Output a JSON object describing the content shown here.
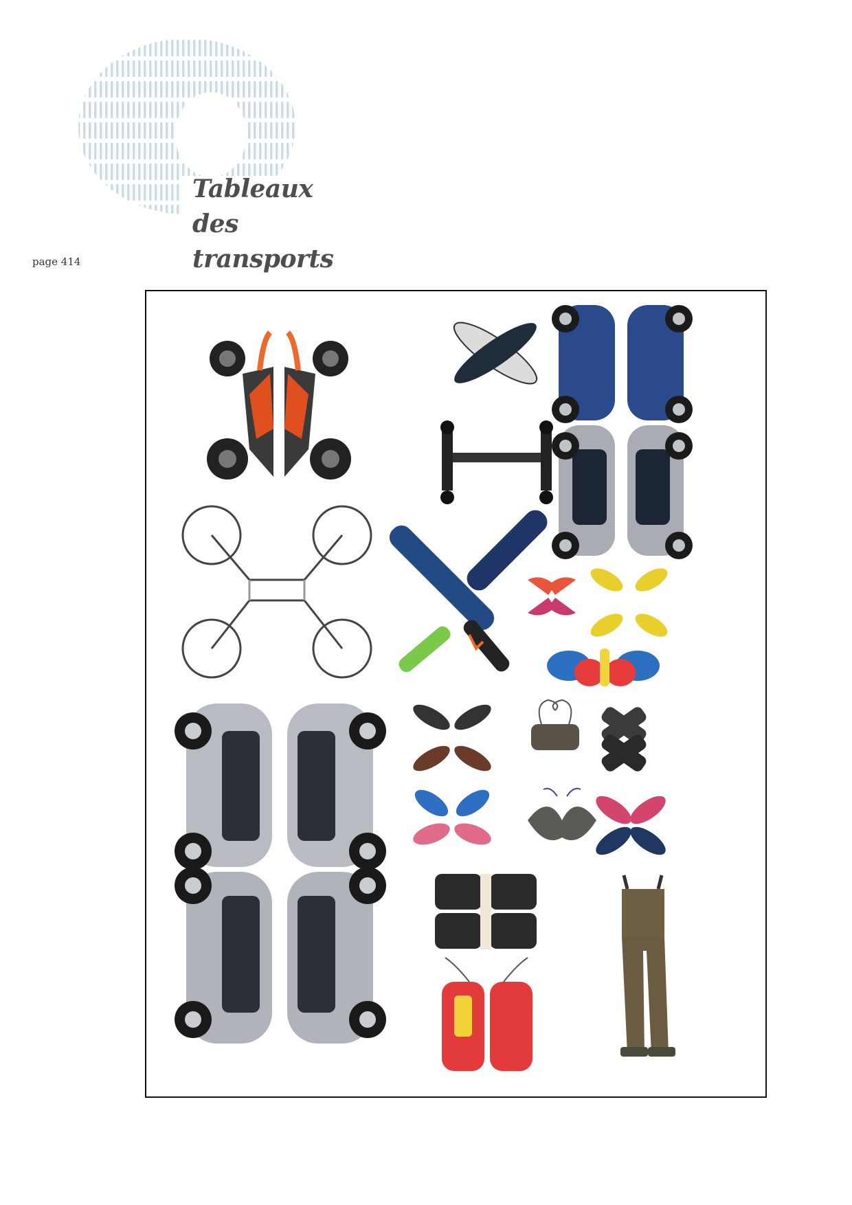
{
  "header": {
    "title_lines": [
      "Tableaux",
      "des",
      "transports"
    ],
    "page_label": "page 414"
  },
  "colors": {
    "title_gray": "#4e4e4e",
    "logo_blue": "#cfe0ea",
    "frame_border": "#111111"
  },
  "collage": {
    "items": [
      {
        "name": "motorcycle-collage-image"
      },
      {
        "name": "ripstik-collage-image"
      },
      {
        "name": "blue-smart-car-collage-image"
      },
      {
        "name": "mountainboard-collage-image"
      },
      {
        "name": "bicycle-collage-image"
      },
      {
        "name": "skateboard-collage-image"
      },
      {
        "name": "heels-collage-image"
      },
      {
        "name": "sneaker-yellow-collage-image"
      },
      {
        "name": "kids-shoes-collage-image"
      },
      {
        "name": "silver-smart-car-collage-image"
      },
      {
        "name": "sandals-collage-image"
      },
      {
        "name": "boots-collage-image"
      },
      {
        "name": "wellies-collage-image"
      },
      {
        "name": "sneakers-blue-pink-collage-image"
      },
      {
        "name": "butterfly-shoes-collage-image"
      },
      {
        "name": "pink-shoes-collage-image"
      },
      {
        "name": "ice-skates-collage-image"
      },
      {
        "name": "sleds-collage-image"
      },
      {
        "name": "waders-collage-image"
      }
    ]
  }
}
